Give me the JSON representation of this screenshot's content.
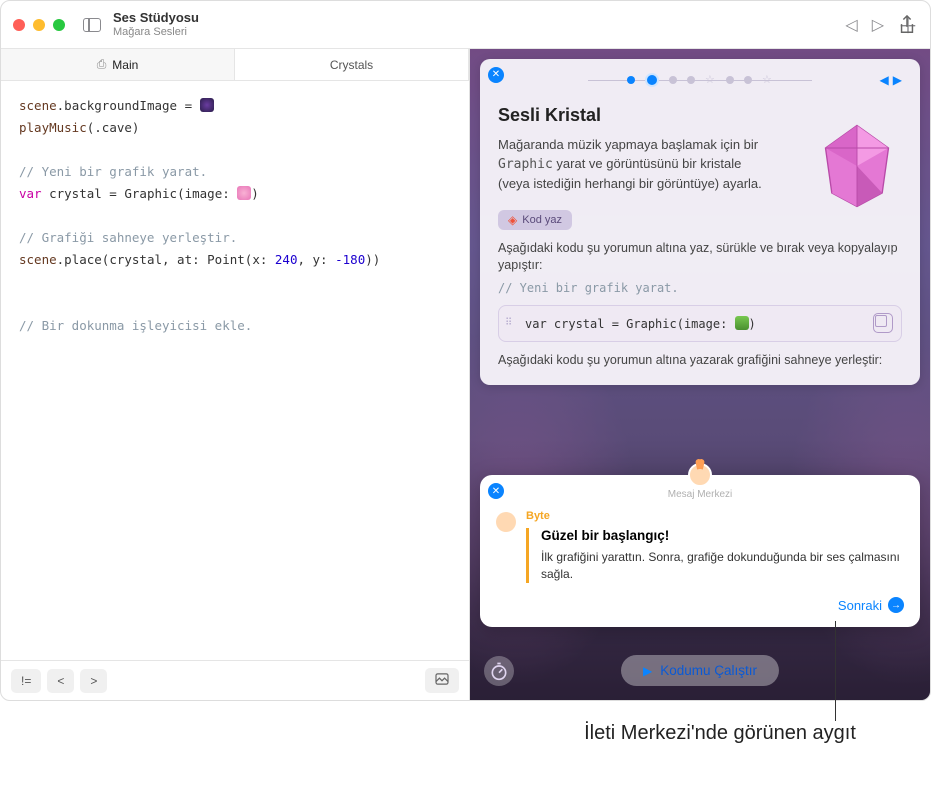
{
  "window": {
    "title": "Ses Stüdyosu",
    "subtitle": "Mağara Sesleri"
  },
  "tabs": {
    "main": "Main",
    "crystals": "Crystals"
  },
  "code": {
    "l1a": "scene",
    "l1b": ".backgroundImage = ",
    "l2a": "playMusic",
    "l2b": "(.",
    "l2c": "cave",
    "l2d": ")",
    "c1": "// Yeni bir grafik yarat.",
    "l3a": "var",
    "l3b": " crystal = ",
    "l3c": "Graphic",
    "l3d": "(image: ",
    "l3e": ")",
    "c2": "// Grafiği sahneye yerleştir.",
    "l4a": "scene",
    "l4b": ".place(crystal, at: ",
    "l4c": "Point",
    "l4d": "(x: ",
    "l4e": "240",
    "l4f": ", y: ",
    "l4g": "-180",
    "l4h": "))",
    "c3": "// Bir dokunma işleyicisi ekle."
  },
  "bottombar": {
    "b1": "!=",
    "b2": "<",
    "b3": ">"
  },
  "card": {
    "title": "Sesli Kristal",
    "desc1": "Mağaranda müzik yapmaya başlamak için bir ",
    "desc_code": "Graphic",
    "desc2": " yarat ve görüntüsünü bir kristale (veya istediğin herhangi bir görüntüye) ayarla.",
    "badge": "Kod yaz",
    "inst1": "Aşağıdaki kodu şu yorumun altına yaz, sürükle ve bırak veya kopyalayıp yapıştır:",
    "comment1": "// Yeni bir grafik yarat.",
    "snippet_kw": "var",
    "snippet_rest": " crystal = Graphic(image: ",
    "snippet_end": ")",
    "inst2": "Aşağıdaki kodu şu yorumun altına yazarak grafiğini sahneye yerleştir:"
  },
  "msg": {
    "center": "Mesaj Merkezi",
    "byte": "Byte",
    "heading": "Güzel bir başlangıç!",
    "body": "İlk grafiğini yarattın. Sonra, grafiğe dokunduğunda bir ses çalmasını sağla.",
    "next": "Sonraki"
  },
  "run": "Kodumu Çalıştır",
  "callout": "İleti Merkezi'nde görünen aygıt"
}
